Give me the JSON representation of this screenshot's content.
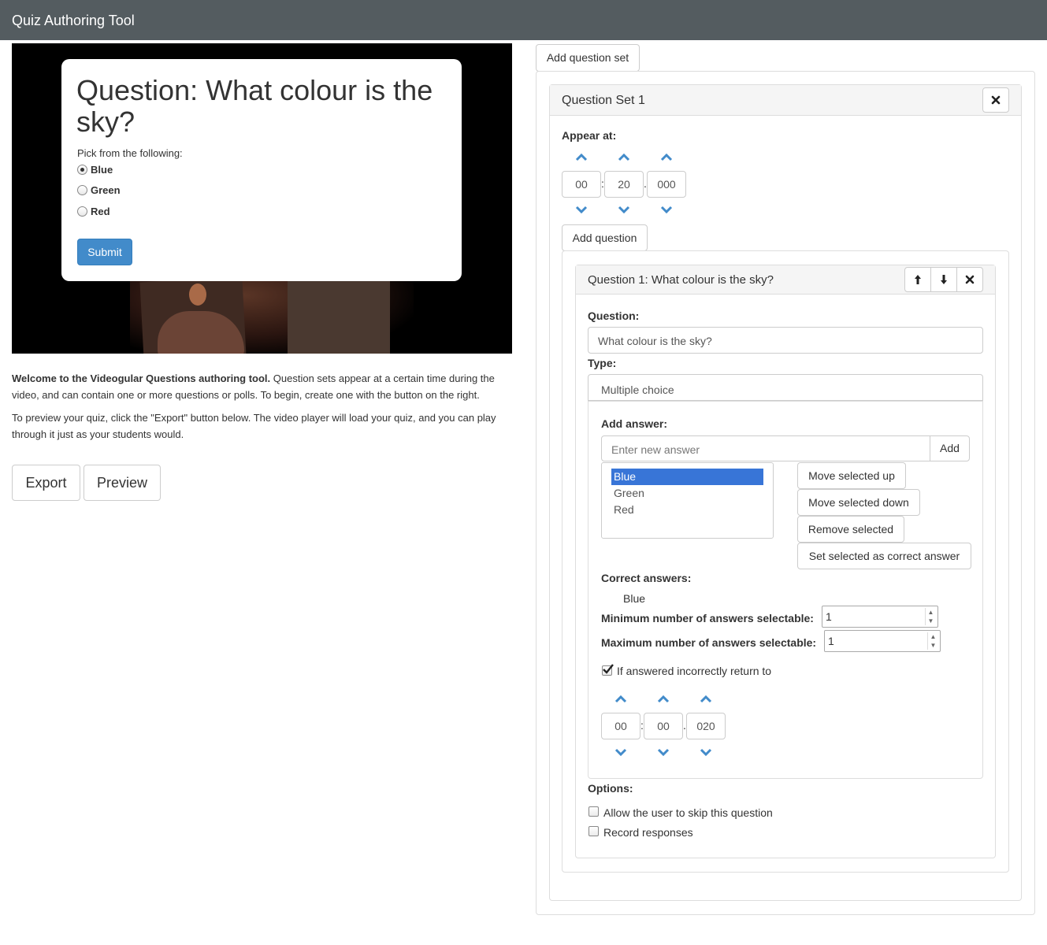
{
  "app": {
    "title": "Quiz Authoring Tool"
  },
  "preview": {
    "question_title": "Question: What colour is the sky?",
    "prompt": "Pick from the following:",
    "options": [
      {
        "label": "Blue",
        "selected": true
      },
      {
        "label": "Green",
        "selected": false
      },
      {
        "label": "Red",
        "selected": false
      }
    ],
    "submit_label": "Submit"
  },
  "intro": {
    "welcome_bold": "Welcome to the Videogular Questions authoring tool.",
    "welcome_rest": " Question sets appear at a certain time during the video, and can contain one or more questions or polls. To begin, create one with the button on the right.",
    "preview_text": "To preview your quiz, click the \"Export\" button below. The video player will load your quiz, and you can play through it just as your students would."
  },
  "actions": {
    "export_label": "Export",
    "preview_label": "Preview"
  },
  "editor": {
    "add_question_set_label": "Add question set",
    "question_set": {
      "title": "Question Set 1",
      "close_icon": "close-icon",
      "appear_at_label": "Appear at:",
      "time": {
        "minutes": "00",
        "seconds": "20",
        "millis": "000",
        "sep1": ":",
        "sep2": "."
      },
      "add_question_label": "Add question",
      "question": {
        "title": "Question 1: What colour is the sky?",
        "question_label": "Question:",
        "question_value": "What colour is the sky?",
        "type_label": "Type:",
        "type_value": "Multiple choice",
        "add_answer_label": "Add answer:",
        "new_answer_placeholder": "Enter new answer",
        "add_button": "Add",
        "answers": [
          "Blue",
          "Green",
          "Red"
        ],
        "selected_answer": "Blue",
        "move_up_label": "Move selected up",
        "move_down_label": "Move selected down",
        "remove_label": "Remove selected",
        "set_correct_label": "Set selected as correct answer",
        "correct_answers_label": "Correct answers:",
        "correct_answers": [
          "Blue"
        ],
        "min_label": "Minimum number of answers selectable:",
        "min_value": "1",
        "max_label": "Maximum number of answers selectable:",
        "max_value": "1",
        "return_label": "If answered incorrectly return to",
        "return_checked": true,
        "return_time": {
          "minutes": "00",
          "seconds": "00",
          "millis": "020",
          "sep1": ":",
          "sep2": "."
        },
        "options_label": "Options:",
        "skip_label": "Allow the user to skip this question",
        "skip_checked": false,
        "record_label": "Record responses",
        "record_checked": false
      }
    }
  },
  "colors": {
    "navbar": "#545c60",
    "primary": "#428bca",
    "selection": "#3875d7",
    "chevron": "#428bca"
  }
}
